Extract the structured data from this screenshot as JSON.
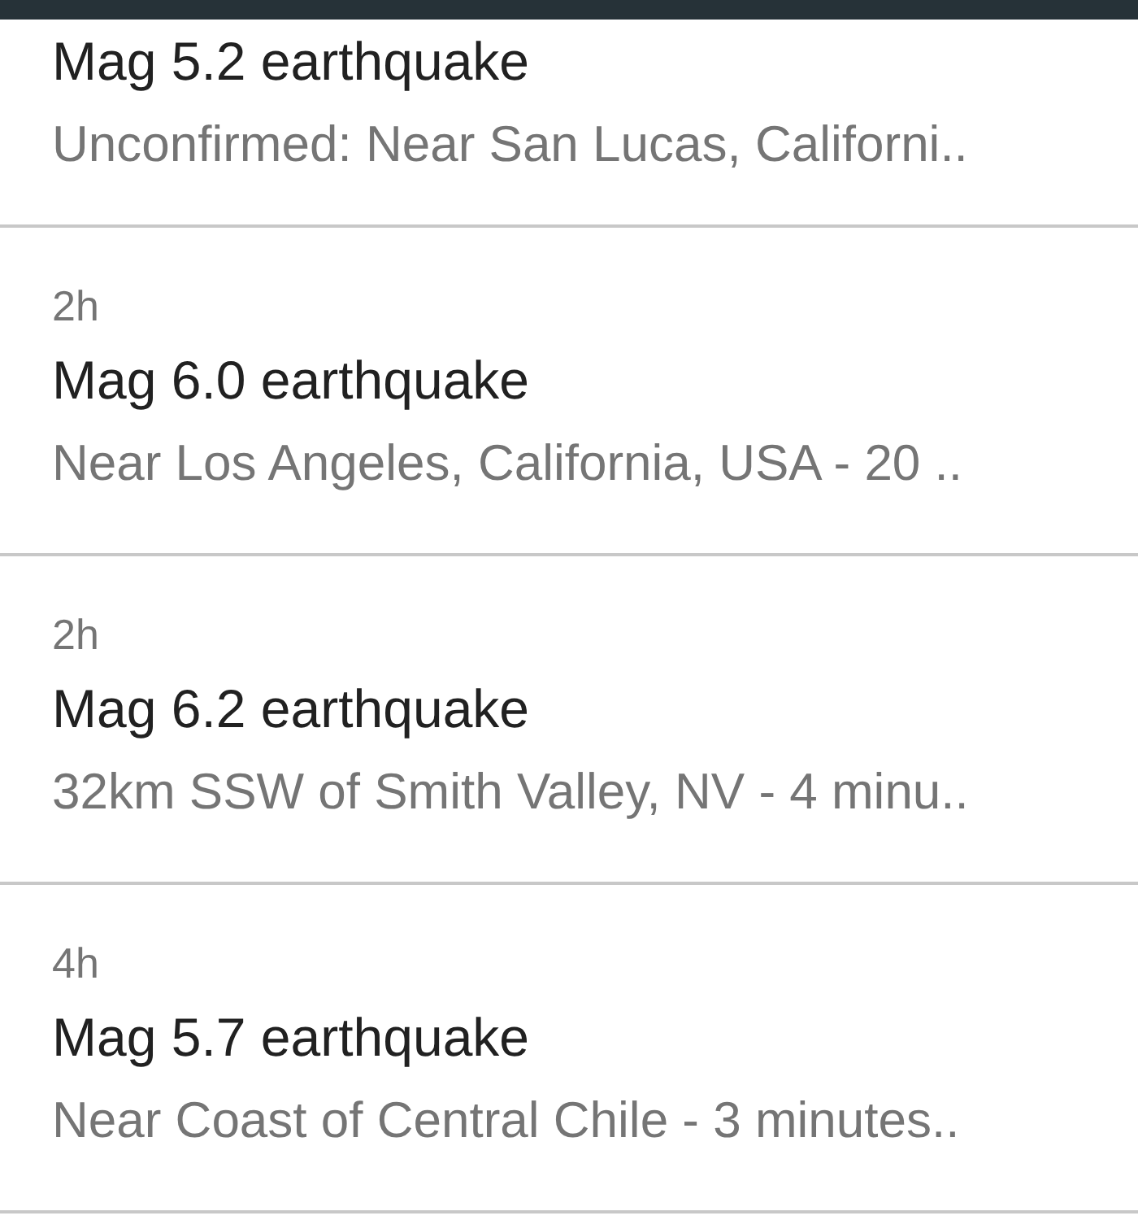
{
  "alerts": [
    {
      "title": "Mag 5.2 earthquake",
      "subtitle": "Unconfirmed: Near San Lucas, Californi.."
    },
    {
      "time": "2h",
      "title": "Mag 6.0 earthquake",
      "subtitle": "Near Los Angeles, California, USA - 20 .."
    },
    {
      "time": "2h",
      "title": "Mag 6.2 earthquake",
      "subtitle": "32km SSW of Smith Valley, NV - 4 minu.."
    },
    {
      "time": "4h",
      "title": "Mag 5.7 earthquake",
      "subtitle": "Near Coast of Central Chile - 3 minutes.."
    }
  ]
}
